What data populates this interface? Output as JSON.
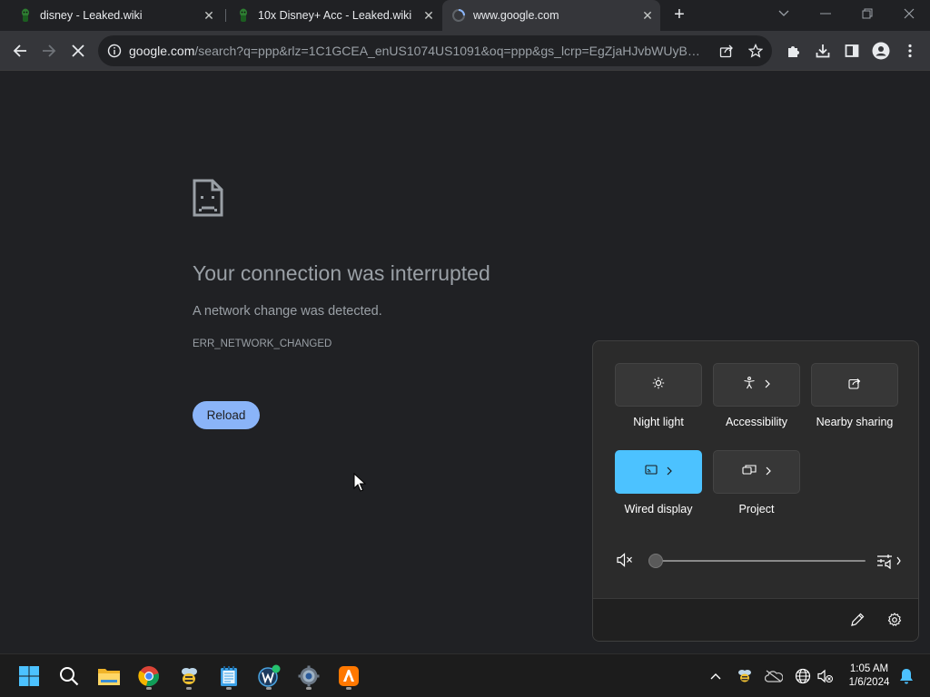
{
  "tabs": [
    {
      "title": "disney - Leaked.wiki",
      "icon": "leaked-wiki-favicon-icon",
      "active": false
    },
    {
      "title": "10x Disney+ Acc - Leaked.wiki",
      "icon": "leaked-wiki-favicon-icon",
      "active": false
    },
    {
      "title": "www.google.com",
      "icon": "loading-spinner-icon",
      "active": true
    }
  ],
  "new_tab_label": "+",
  "omnibox": {
    "host": "google.com",
    "path": "/search?q=ppp&rlz=1C1GCEA_enUS1074US1091&oq=ppp&gs_lcrp=EgZjaHJvbWUyBggA..."
  },
  "error_page": {
    "title": "Your connection was interrupted",
    "description": "A network change was detected.",
    "code": "ERR_NETWORK_CHANGED",
    "reload_label": "Reload"
  },
  "quick_settings": {
    "tiles": [
      {
        "label": "Night light",
        "icon": "brightness-icon",
        "active": false,
        "expand": false
      },
      {
        "label": "Accessibility",
        "icon": "accessibility-icon",
        "active": false,
        "expand": true
      },
      {
        "label": "Nearby sharing",
        "icon": "share-icon",
        "active": false,
        "expand": false
      },
      {
        "label": "Wired display",
        "icon": "cast-icon",
        "active": true,
        "expand": true
      },
      {
        "label": "Project",
        "icon": "project-icon",
        "active": false,
        "expand": true
      }
    ],
    "volume_level": 0,
    "volume_muted": true
  },
  "taskbar": {
    "apps": [
      "start-icon",
      "search-icon",
      "file-explorer-icon",
      "chrome-icon",
      "bee-app-icon",
      "notepad-icon",
      "wing-app-icon",
      "settings-icon",
      "avast-icon"
    ],
    "clock_time": "1:05 AM",
    "clock_date": "1/6/2024"
  },
  "colors": {
    "accent_blue": "#8ab4f8",
    "tile_active": "#4cc2ff",
    "page_bg": "#202124"
  }
}
